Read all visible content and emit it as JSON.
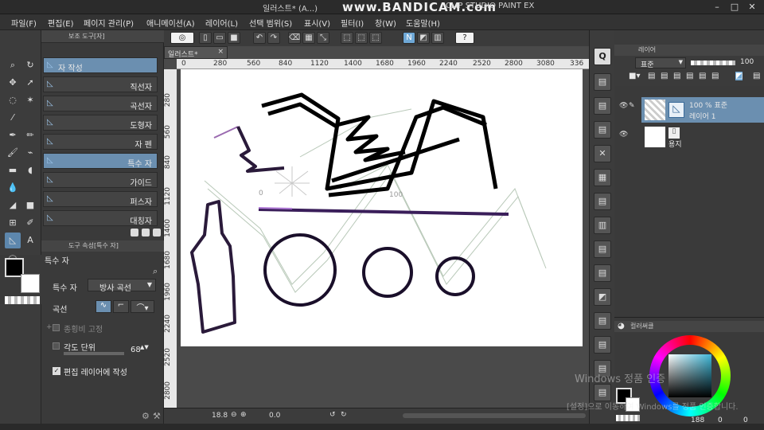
{
  "window": {
    "title": "일러스트* (A...)",
    "recorder_watermark": "www.BANDICAM.com",
    "app_name": "CLIP STUDIO PAINT EX",
    "controls": [
      "–",
      "□",
      "✕"
    ]
  },
  "menu": [
    "파일(F)",
    "편집(E)",
    "페이지 관리(P)",
    "애니메이션(A)",
    "레이어(L)",
    "선택 범위(S)",
    "표시(V)",
    "필터(I)",
    "창(W)",
    "도움말(H)"
  ],
  "tool_palette": {
    "icons": [
      "zoom-icon",
      "rotate-icon",
      "move-layer-icon",
      "operation-icon",
      "lasso-icon",
      "magic-wand-icon",
      "eyedropper-icon",
      "pen-icon",
      "pencil-icon",
      "brush-icon",
      "airbrush-icon",
      "eraser-icon",
      "blend-icon",
      "fill-icon",
      "gradient-icon",
      "figure-icon",
      "frame-icon",
      "ruler-icon",
      "text-icon",
      "balloon-icon",
      "correction-icon"
    ],
    "main_color": "#000000",
    "sub_color": "#ffffff"
  },
  "subtool_panel": {
    "title": "보조 도구[자]",
    "items": [
      {
        "label": "자 작성",
        "active": true
      },
      {
        "label": "직선자",
        "active": false
      },
      {
        "label": "곡선자",
        "active": false
      },
      {
        "label": "도형자",
        "active": false
      },
      {
        "label": "자 펜",
        "active": false
      },
      {
        "label": "특수 자",
        "active": true
      },
      {
        "label": "가이드",
        "active": false
      },
      {
        "label": "퍼스자",
        "active": false
      },
      {
        "label": "대칭자",
        "active": false
      }
    ]
  },
  "tool_property": {
    "title": "도구 속성[특수 자]",
    "tool_name": "특수 자",
    "special_ruler_label": "특수 자",
    "special_ruler_value": "방사 곡선",
    "curve_label": "곡선",
    "fix_ratio_label": "종횡비 고정",
    "angle_step_label": "각도 단위",
    "angle_step_value": "68",
    "create_on_edit_label": "편집 레이어에 작성"
  },
  "document": {
    "tab_title": "일러스트*",
    "h_ruler_ticks": [
      "0",
      "280",
      "560",
      "840",
      "1120",
      "1400",
      "1680",
      "1960",
      "2240",
      "2520",
      "2800",
      "3080",
      "336"
    ],
    "v_ruler_ticks": [
      "280",
      "560",
      "840",
      "1120",
      "1400",
      "1680",
      "1960",
      "2240",
      "2520",
      "2800"
    ],
    "ruler_label_0": "0",
    "ruler_label_100": "100"
  },
  "status": {
    "zoom": "18.8",
    "angle": "0.0"
  },
  "layer_panel": {
    "title": "레이어",
    "blend_mode": "표준",
    "opacity": "100",
    "layers": [
      {
        "name": "레이어 1",
        "info": "100 % 표준",
        "selected": true
      },
      {
        "name": "용지",
        "info": "",
        "selected": false
      }
    ]
  },
  "color_panel": {
    "title": "컬러써클",
    "hue_color": "#3fb8d8",
    "values": [
      "188",
      "0",
      "0"
    ]
  },
  "os_watermark": {
    "line1": "Windows 정품 인증",
    "line2": "[설정]으로 이동하여 Windows를 정품 인증합니다."
  }
}
